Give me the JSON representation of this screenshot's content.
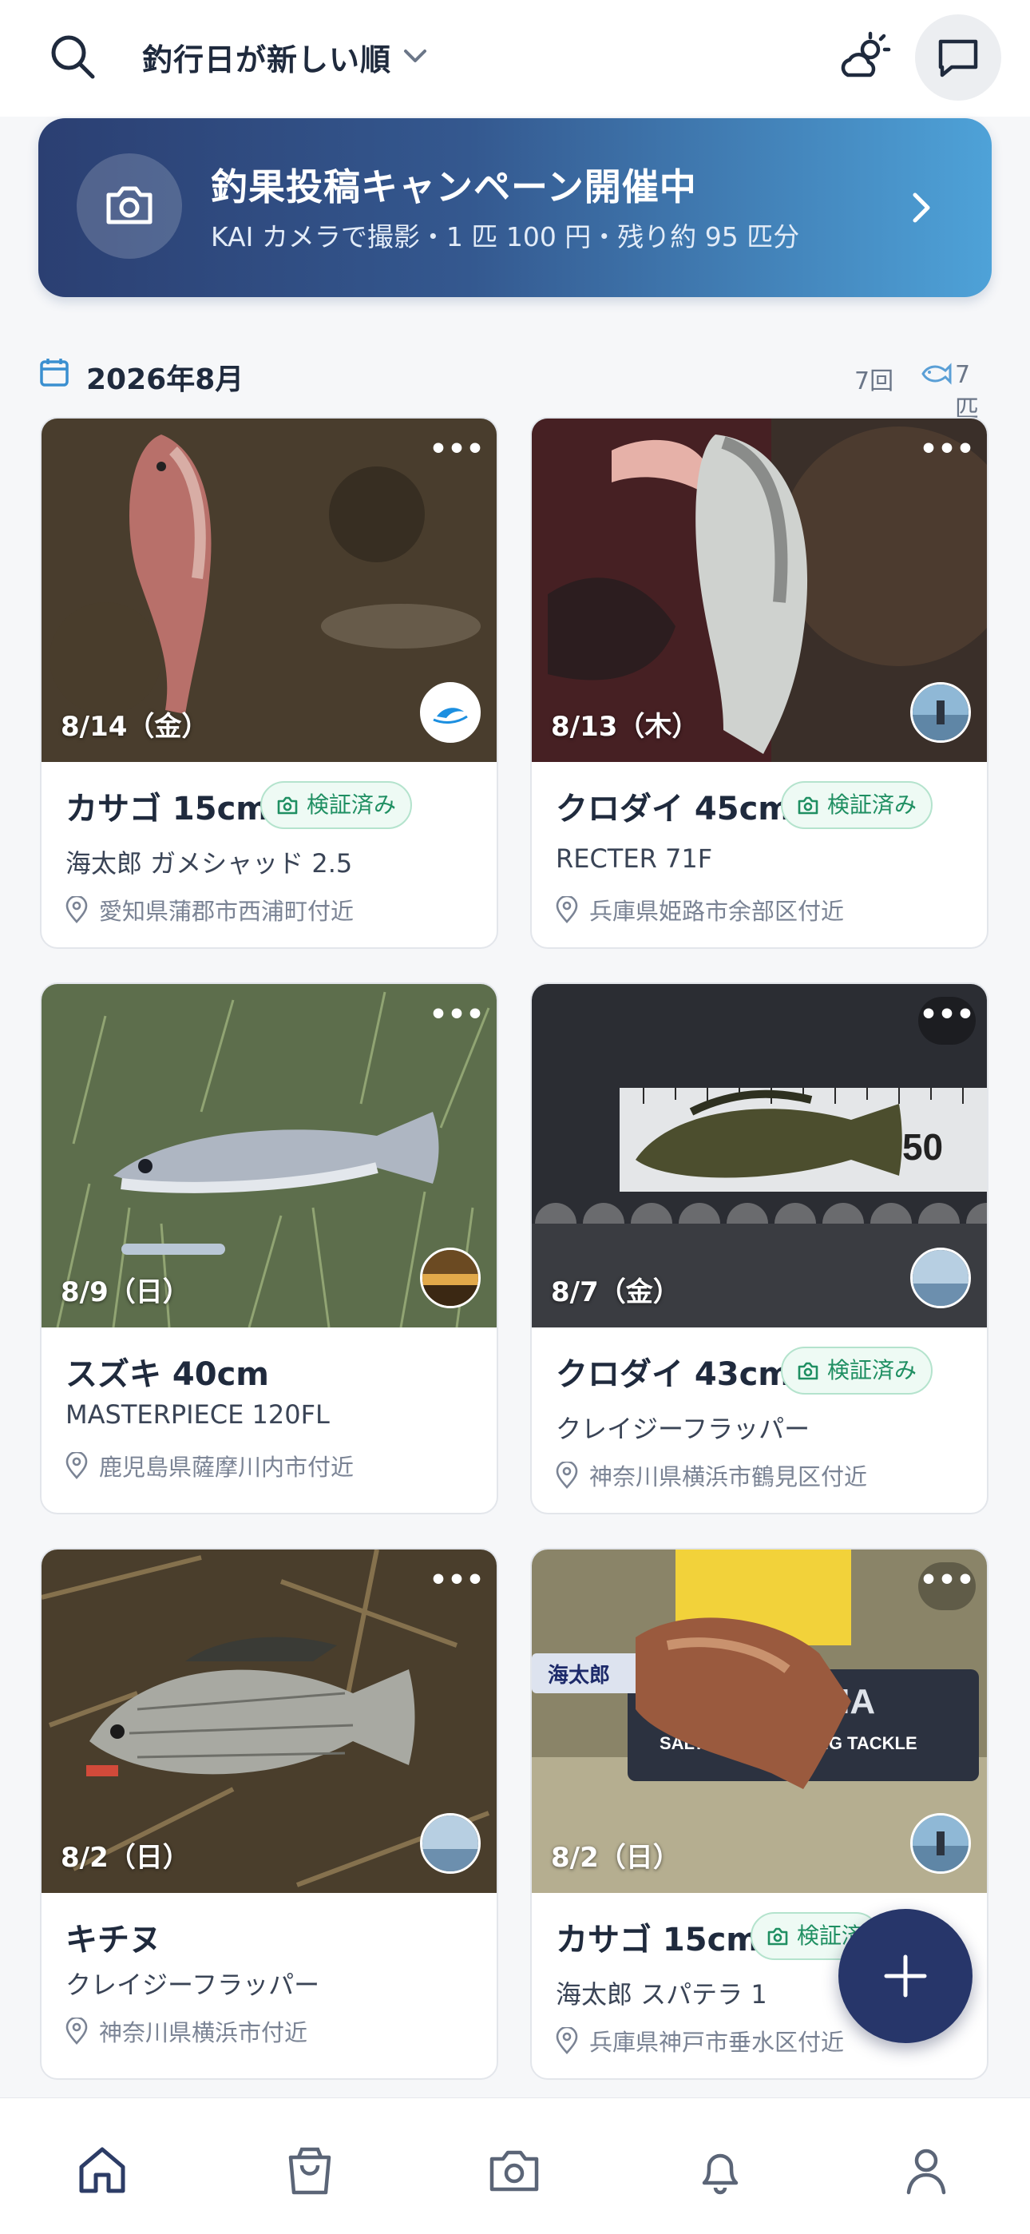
{
  "header": {
    "sort_label": "釣行日が新しい順",
    "icons": [
      "search-icon",
      "chevron-down-icon",
      "weather-icon",
      "chat-icon"
    ]
  },
  "banner": {
    "title": "釣果投稿キャンペーン開催中",
    "subtitle": "KAI カメラで撮影・1 匹 100 円・残り約 95 匹分",
    "icon": "camera-icon"
  },
  "month": {
    "label": "2026年8月",
    "trips": "7回",
    "fish": "7匹"
  },
  "cards": [
    {
      "date": "8/14（金）",
      "title": "カサゴ 15cm",
      "badge": "検証済み",
      "lure": "海太郎 ガメシャッド 2.5",
      "location": "愛知県蒲郡市西浦町付近"
    },
    {
      "date": "8/13（木）",
      "title": "クロダイ 45cm",
      "badge": "検証済み",
      "lure": "RECTER 71F",
      "location": "兵庫県姫路市余部区付近"
    },
    {
      "date": "8/9（日）",
      "title": "スズキ 40cm",
      "badge": "",
      "lure": "MASTERPIECE 120FL",
      "location": "鹿児島県薩摩川内市付近"
    },
    {
      "date": "8/7（金）",
      "title": "クロダイ 43cm",
      "badge": "検証済み",
      "lure": "クレイジーフラッパー",
      "location": "神奈川県横浜市鶴見区付近"
    },
    {
      "date": "8/2（日）",
      "title": "キチヌ",
      "badge": "",
      "lure": "クレイジーフラッパー",
      "location": "神奈川県横浜市付近"
    },
    {
      "date": "8/2（日）",
      "title": "カサゴ 15cm",
      "badge": "検証済",
      "lure": "海太郎 スパテラ 1",
      "location": "兵庫県神戸市垂水区付近"
    }
  ],
  "photo_text": {
    "ruler": "40 50",
    "box_brand": "AMA",
    "box_sub": "SALTWATER FISHING TACKLE",
    "sticker": "海太郎"
  },
  "colors": {
    "banner_start": "#2b3f72",
    "banner_end": "#4ea2d8",
    "badge_green": "#1f8f62",
    "fab": "#27366a"
  },
  "bottom_nav": [
    "home-icon",
    "shopping-bag-icon",
    "camera-icon",
    "bell-icon",
    "user-icon"
  ]
}
